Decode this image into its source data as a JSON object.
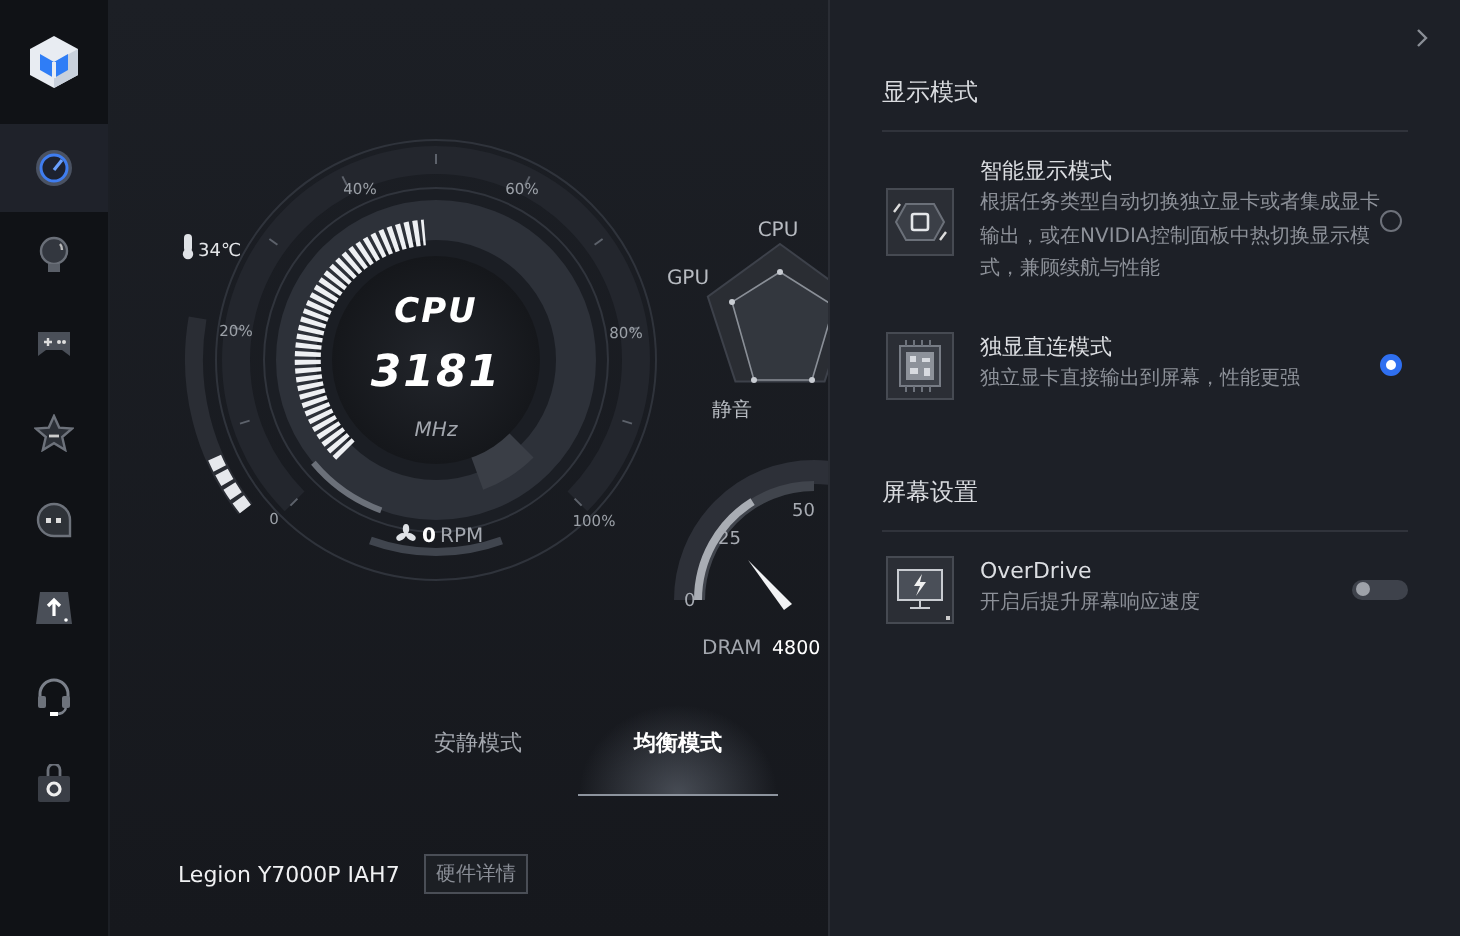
{
  "sidebar": {
    "items": [
      {
        "selected": true
      },
      {
        "selected": false
      },
      {
        "selected": false
      },
      {
        "selected": false
      },
      {
        "selected": false
      },
      {
        "selected": false
      },
      {
        "selected": false
      },
      {
        "selected": false
      }
    ]
  },
  "cpu_gauge": {
    "title": "CPU",
    "value": "3181",
    "unit": "MHz",
    "ticks": [
      "0",
      "20%",
      "40%",
      "60%",
      "80%",
      "100%"
    ],
    "fan_speed": "0",
    "fan_unit": "RPM",
    "temperature": {
      "text": "34℃"
    }
  },
  "radar": {
    "labels": [
      "CPU",
      "GPU",
      "静音"
    ]
  },
  "dram_gauge": {
    "ticks": [
      "0",
      "25",
      "50"
    ],
    "label": "DRAM",
    "value": "4800"
  },
  "modes": [
    {
      "label": "安静模式",
      "selected": false
    },
    {
      "label": "均衡模式",
      "selected": true
    }
  ],
  "device": {
    "name": "Legion Y7000P IAH7",
    "button": "硬件详情"
  },
  "display_mode": {
    "title": "显示模式",
    "options": [
      {
        "title": "智能显示模式",
        "description": "根据任务类型自动切换独立显卡或者集成显卡输出，或在NVIDIA控制面板中热切换显示模式，兼顾续航与性能",
        "selected": false
      },
      {
        "title": "独显直连模式",
        "description": "独立显卡直接输出到屏幕，性能更强",
        "selected": true
      }
    ]
  },
  "screen_settings": {
    "title": "屏幕设置",
    "items": [
      {
        "title": "OverDrive",
        "description": "开启后提升屏幕响应速度",
        "on": false
      }
    ]
  }
}
